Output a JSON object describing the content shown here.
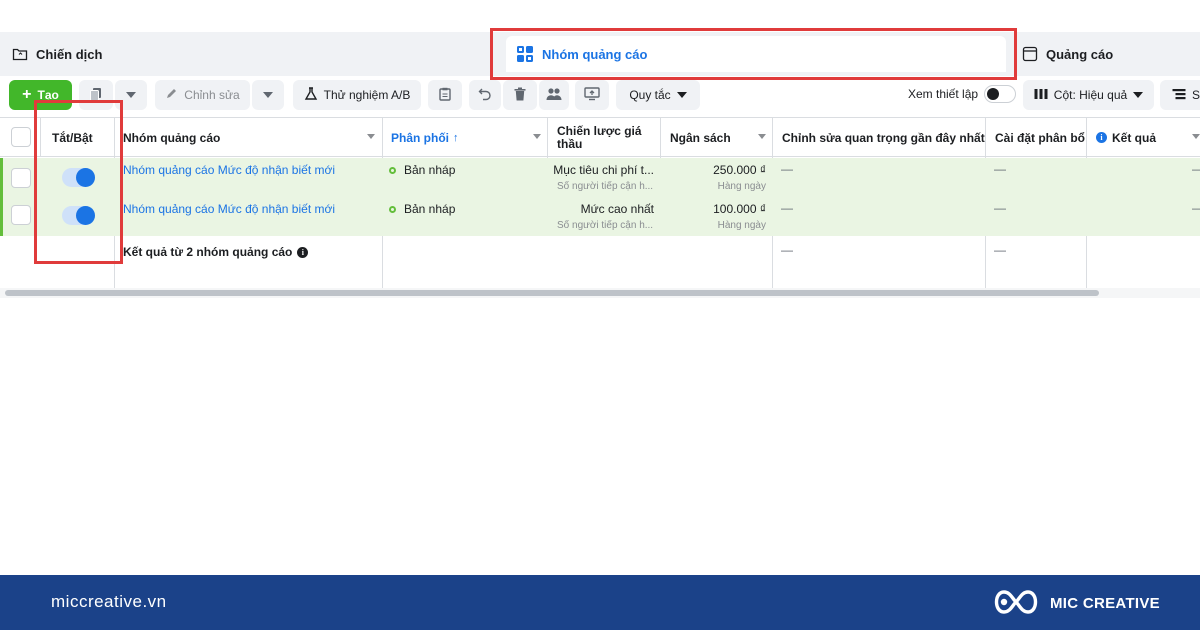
{
  "tabs": {
    "campaign": "Chiến dịch",
    "adset": "Nhóm quảng cáo",
    "ads": "Quảng cáo"
  },
  "toolbar": {
    "create": "Tạo",
    "edit": "Chỉnh sửa",
    "ab_test": "Thử nghiệm A/B",
    "rules": "Quy tắc",
    "view_setup": "Xem thiết lập",
    "columns": "Cột: Hiệu quả",
    "breakdown": "Sự"
  },
  "table": {
    "headers": {
      "toggle": "Tắt/Bật",
      "name": "Nhóm quảng cáo",
      "delivery": "Phân phối",
      "delivery_sort": "↑",
      "bid_strategy": "Chiến lược giá thầu",
      "budget": "Ngân sách",
      "recent_edits": "Chỉnh sửa quan trọng gần đây nhất",
      "attribution": "Cài đặt phân bổ",
      "results": "Kết quả"
    },
    "rows": [
      {
        "name": "Nhóm quảng cáo Mức độ nhận biết mới",
        "delivery": "Bản nháp",
        "bid_strategy": "Mục tiêu chi phí t...",
        "bid_sub": "Số người tiếp cận h...",
        "budget": "250.000 ₫",
        "budget_sub": "Hàng ngày",
        "recent_edits": "—",
        "attribution": "—",
        "results": "—",
        "enabled": true
      },
      {
        "name": "Nhóm quảng cáo Mức độ nhận biết mới",
        "delivery": "Bản nháp",
        "bid_strategy": "Mức cao nhất",
        "bid_sub": "Số người tiếp cận h...",
        "budget": "100.000 ₫",
        "budget_sub": "Hàng ngày",
        "recent_edits": "—",
        "attribution": "—",
        "results": "—",
        "enabled": true
      }
    ],
    "summary": {
      "label": "Kết quả từ 2 nhóm quảng cáo",
      "recent_edits": "—",
      "attribution": "—"
    }
  },
  "footer": {
    "site": "miccreative.vn",
    "brand": "MIC CREATIVE"
  },
  "colors": {
    "accent_blue": "#1b74e4",
    "create_green": "#42b72a",
    "highlight_red": "#e03b3b",
    "footer_blue": "#1b4289",
    "selected_row": "#eaf5e3"
  }
}
